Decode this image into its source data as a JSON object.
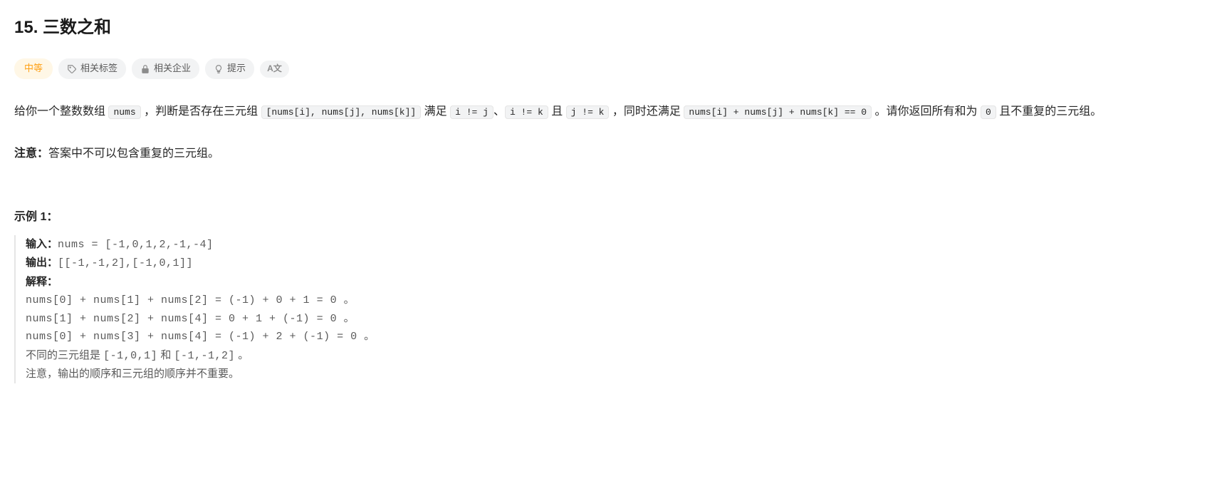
{
  "title": "15. 三数之和",
  "tags": {
    "difficulty": "中等",
    "related_tags": "相关标签",
    "related_companies": "相关企业",
    "hints": "提示"
  },
  "description": {
    "part1": "给你一个整数数组 ",
    "code1": "nums",
    "part2": " ，判断是否存在三元组 ",
    "code2": "[nums[i], nums[j], nums[k]]",
    "part3": " 满足 ",
    "code3": "i != j",
    "part4": "、",
    "code4": "i != k",
    "part5": " 且 ",
    "code5": "j != k",
    "part6": " ，同时还满足 ",
    "code6": "nums[i] + nums[j] + nums[k] == 0",
    "part7": " 。请你返回所有和为 ",
    "code7": "0",
    "part8": " 且不重复的三元组。"
  },
  "note": {
    "label": "注意：",
    "text": "答案中不可以包含重复的三元组。"
  },
  "example1": {
    "heading": "示例 1：",
    "input_label": "输入：",
    "input_value": "nums = [-1,0,1,2,-1,-4]",
    "output_label": "输出：",
    "output_value": "[[-1,-1,2],[-1,0,1]]",
    "explain_label": "解释：",
    "line1": "nums[0] + nums[1] + nums[2] = (-1) + 0 + 1 = 0 。",
    "line2": "nums[1] + nums[2] + nums[4] = 0 + 1 + (-1) = 0 。",
    "line3": "nums[0] + nums[3] + nums[4] = (-1) + 2 + (-1) = 0 。",
    "line4_a": "不同的三元组是 ",
    "line4_code1": "[-1,0,1]",
    "line4_b": " 和 ",
    "line4_code2": "[-1,-1,2]",
    "line4_c": " 。",
    "line5": "注意，输出的顺序和三元组的顺序并不重要。"
  }
}
